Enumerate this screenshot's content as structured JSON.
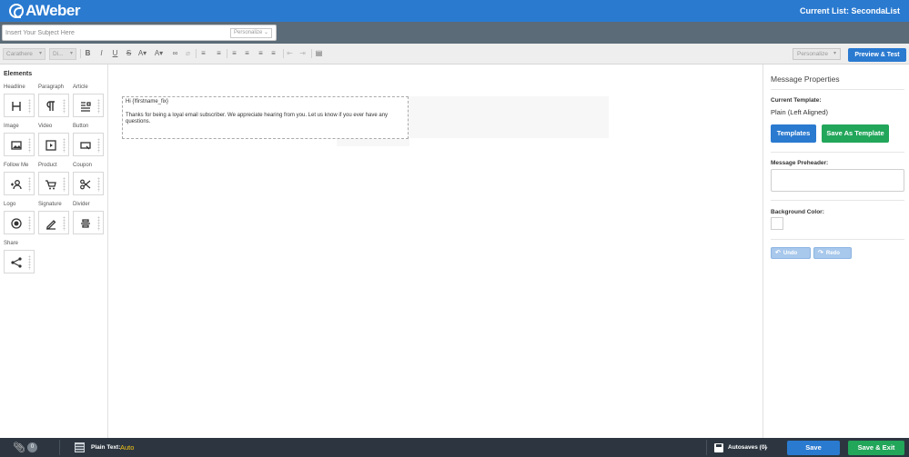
{
  "app": {
    "brand": "AWeber",
    "current_list": "Current List: SecondaList"
  },
  "subject": {
    "placeholder": "Insert Your Subject Here",
    "personalize": "Personalize"
  },
  "toolbar": {
    "font_family": "Carathere",
    "font_size": "Di...",
    "buttons": [
      {
        "name": "bold-button",
        "glyph": "B"
      },
      {
        "name": "italic-button",
        "glyph": "I"
      },
      {
        "name": "underline-button",
        "glyph": "U"
      },
      {
        "name": "strikethrough-button",
        "glyph": "S"
      },
      {
        "name": "font-color-button",
        "glyph": "A▾"
      },
      {
        "name": "highlight-color-button",
        "glyph": "A▾"
      },
      {
        "name": "link-button",
        "glyph": "∞"
      },
      {
        "name": "unlink-button",
        "glyph": "⌀"
      },
      {
        "name": "numbered-list-button",
        "glyph": "≡"
      },
      {
        "name": "bulleted-list-button",
        "glyph": "≡"
      },
      {
        "name": "align-left-button",
        "glyph": "≡"
      },
      {
        "name": "align-center-button",
        "glyph": "≡"
      },
      {
        "name": "align-right-button",
        "glyph": "≡"
      },
      {
        "name": "align-justify-button",
        "glyph": "≡"
      },
      {
        "name": "outdent-button",
        "glyph": "⇤"
      },
      {
        "name": "indent-button",
        "glyph": "⇥"
      },
      {
        "name": "source-button",
        "glyph": "▤"
      }
    ],
    "personalize": "Personalize",
    "preview_test": "Preview & Test"
  },
  "elements": {
    "title": "Elements",
    "items": [
      {
        "label": "Headline",
        "icon": "headline-icon"
      },
      {
        "label": "Paragraph",
        "icon": "paragraph-icon"
      },
      {
        "label": "Article",
        "icon": "article-icon"
      },
      {
        "label": "Image",
        "icon": "image-icon"
      },
      {
        "label": "Video",
        "icon": "video-icon"
      },
      {
        "label": "Button",
        "icon": "button-icon"
      },
      {
        "label": "Follow Me",
        "icon": "follow-me-icon"
      },
      {
        "label": "Product",
        "icon": "product-icon"
      },
      {
        "label": "Coupon",
        "icon": "coupon-icon"
      },
      {
        "label": "Logo",
        "icon": "logo-icon"
      },
      {
        "label": "Signature",
        "icon": "signature-icon"
      },
      {
        "label": "Divider",
        "icon": "divider-icon"
      },
      {
        "label": "Share",
        "icon": "share-icon"
      }
    ]
  },
  "message": {
    "greeting": "Hi {!firstname_fix}",
    "body": "Thanks for being a loyal email subscriber. We appreciate hearing from you. Let us know if you ever have any questions."
  },
  "properties": {
    "title": "Message Properties",
    "current_template_label": "Current Template:",
    "current_template_value": "Plain (Left Aligned)",
    "templates_button": "Templates",
    "save_as_template_button": "Save As Template",
    "preheader_label": "Message Preheader:",
    "background_color_label": "Background Color:",
    "undo": "Undo",
    "redo": "Redo"
  },
  "footer": {
    "attachments_count": "0",
    "plain_text_label": "Plain Text:",
    "plain_text_value": "Auto",
    "autosaves": "Autosaves (0)",
    "save": "Save",
    "save_exit": "Save & Exit"
  },
  "colors": {
    "brand_blue": "#2a7ad0",
    "green": "#22a65a",
    "footer_dark": "#2d3640",
    "plain_text_accent": "#f3c317"
  }
}
